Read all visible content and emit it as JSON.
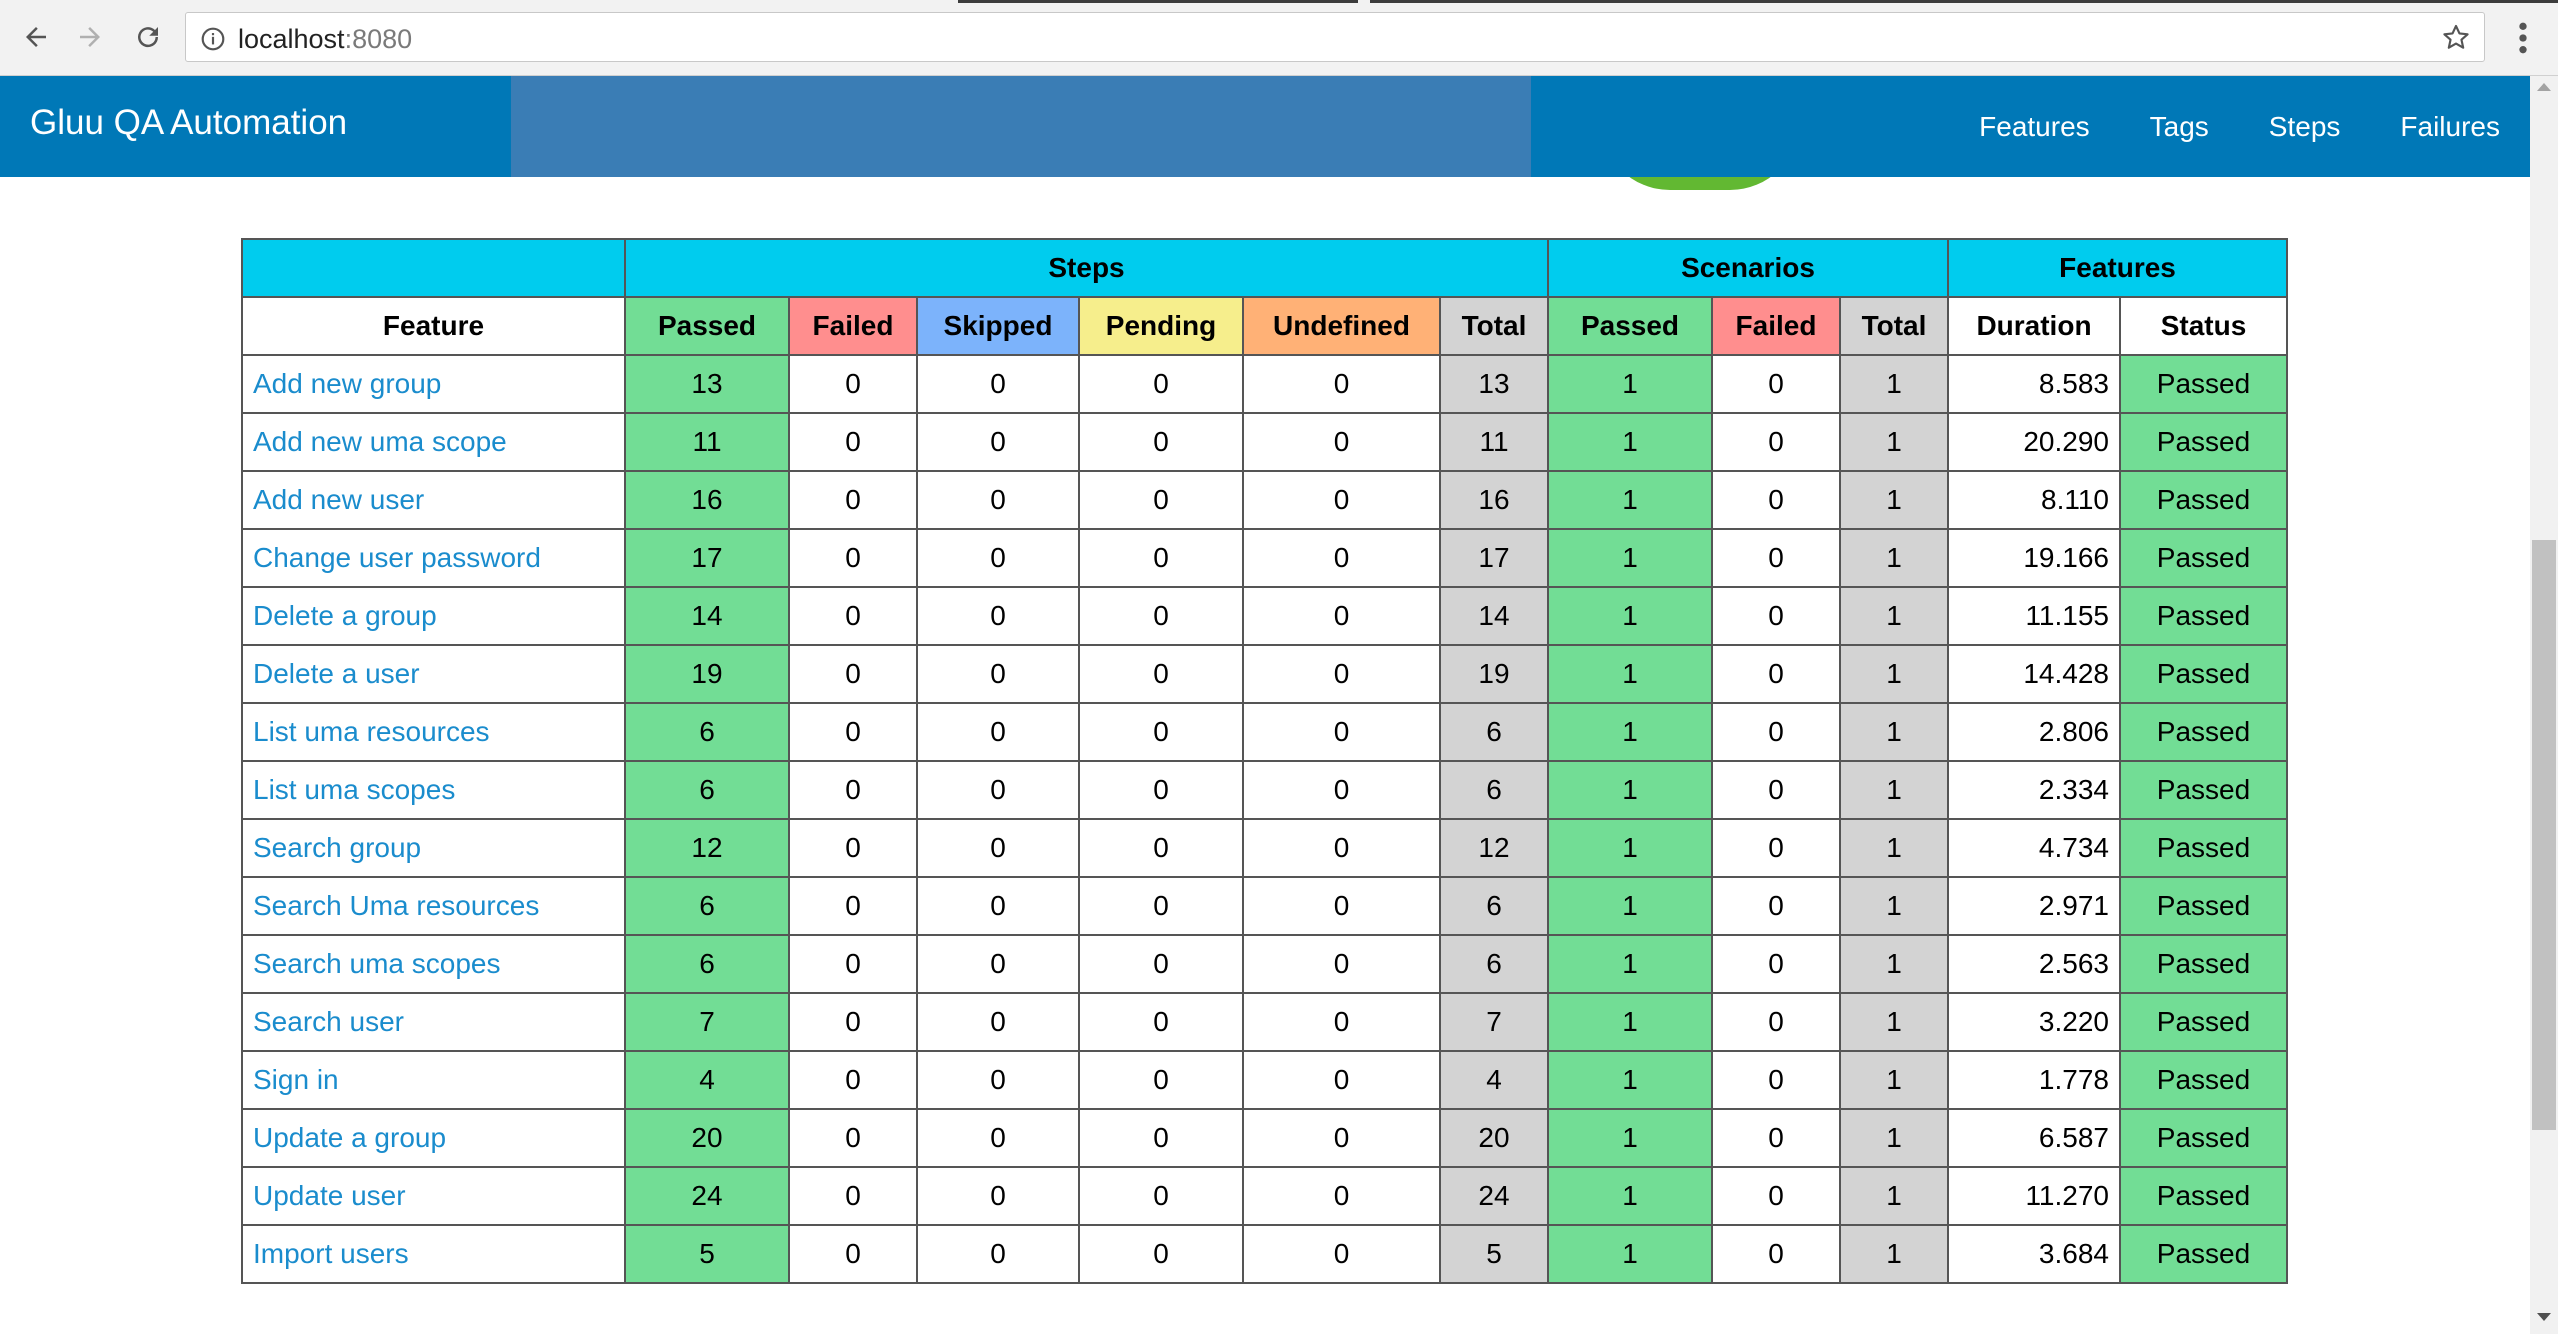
{
  "browser": {
    "url_host": "localhost",
    "url_port": ":8080"
  },
  "navbar": {
    "brand": "Gluu QA Automation",
    "links": [
      "Features",
      "Tags",
      "Steps",
      "Failures"
    ]
  },
  "table": {
    "group_headers": {
      "steps": "Steps",
      "scenarios": "Scenarios",
      "features": "Features"
    },
    "columns": [
      "Feature",
      "Passed",
      "Failed",
      "Skipped",
      "Pending",
      "Undefined",
      "Total",
      "Passed",
      "Failed",
      "Total",
      "Duration",
      "Status"
    ],
    "rows": [
      [
        "Add new group",
        "13",
        "0",
        "0",
        "0",
        "0",
        "13",
        "1",
        "0",
        "1",
        "8.583",
        "Passed"
      ],
      [
        "Add new uma scope",
        "11",
        "0",
        "0",
        "0",
        "0",
        "11",
        "1",
        "0",
        "1",
        "20.290",
        "Passed"
      ],
      [
        "Add new user",
        "16",
        "0",
        "0",
        "0",
        "0",
        "16",
        "1",
        "0",
        "1",
        "8.110",
        "Passed"
      ],
      [
        "Change user password",
        "17",
        "0",
        "0",
        "0",
        "0",
        "17",
        "1",
        "0",
        "1",
        "19.166",
        "Passed"
      ],
      [
        "Delete a group",
        "14",
        "0",
        "0",
        "0",
        "0",
        "14",
        "1",
        "0",
        "1",
        "11.155",
        "Passed"
      ],
      [
        "Delete a user",
        "19",
        "0",
        "0",
        "0",
        "0",
        "19",
        "1",
        "0",
        "1",
        "14.428",
        "Passed"
      ],
      [
        "List uma resources",
        "6",
        "0",
        "0",
        "0",
        "0",
        "6",
        "1",
        "0",
        "1",
        "2.806",
        "Passed"
      ],
      [
        "List uma scopes",
        "6",
        "0",
        "0",
        "0",
        "0",
        "6",
        "1",
        "0",
        "1",
        "2.334",
        "Passed"
      ],
      [
        "Search group",
        "12",
        "0",
        "0",
        "0",
        "0",
        "12",
        "1",
        "0",
        "1",
        "4.734",
        "Passed"
      ],
      [
        "Search Uma resources",
        "6",
        "0",
        "0",
        "0",
        "0",
        "6",
        "1",
        "0",
        "1",
        "2.971",
        "Passed"
      ],
      [
        "Search uma scopes",
        "6",
        "0",
        "0",
        "0",
        "0",
        "6",
        "1",
        "0",
        "1",
        "2.563",
        "Passed"
      ],
      [
        "Search user",
        "7",
        "0",
        "0",
        "0",
        "0",
        "7",
        "1",
        "0",
        "1",
        "3.220",
        "Passed"
      ],
      [
        "Sign in",
        "4",
        "0",
        "0",
        "0",
        "0",
        "4",
        "1",
        "0",
        "1",
        "1.778",
        "Passed"
      ],
      [
        "Update a group",
        "20",
        "0",
        "0",
        "0",
        "0",
        "20",
        "1",
        "0",
        "1",
        "6.587",
        "Passed"
      ],
      [
        "Update user",
        "24",
        "0",
        "0",
        "0",
        "0",
        "24",
        "1",
        "0",
        "1",
        "11.270",
        "Passed"
      ],
      [
        "Import users",
        "5",
        "0",
        "0",
        "0",
        "0",
        "5",
        "1",
        "0",
        "1",
        "3.684",
        "Passed"
      ]
    ]
  },
  "colors": {
    "navbar": "#0078b7",
    "group_header": "#00ccee",
    "passed": "#72dd95",
    "failed": "#ff8e8e",
    "skipped": "#7cb3fb",
    "pending": "#f6ee8c",
    "undefined": "#ffb176",
    "total": "#d3d3d3",
    "link": "#1a8ccd"
  },
  "icons": [
    "back-arrow-icon",
    "forward-arrow-icon",
    "reload-icon",
    "info-icon",
    "star-icon",
    "more-vert-icon",
    "scroll-up-icon",
    "scroll-down-icon"
  ]
}
